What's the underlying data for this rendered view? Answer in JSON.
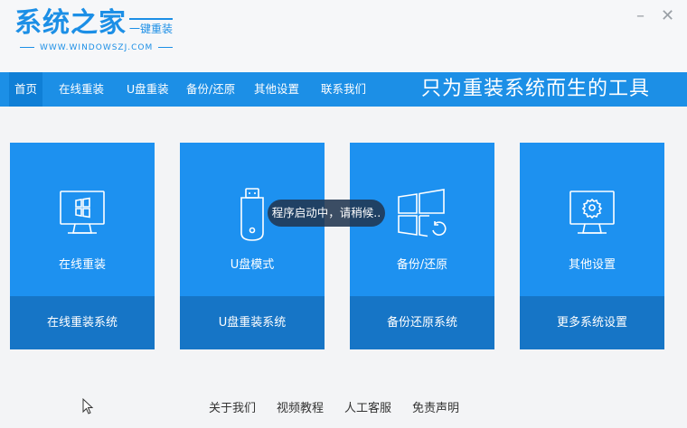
{
  "app": {
    "logo_main": "系统之家",
    "logo_sub": "一键重装",
    "logo_url": "WWW.WINDOWSZJ.COM"
  },
  "window": {
    "minimize": "–",
    "close": "✕"
  },
  "nav": {
    "items": [
      "首页",
      "在线重装",
      "U盘重装",
      "备份/还原",
      "其他设置",
      "联系我们"
    ],
    "active_index": 0,
    "slogan": "只为重装系统而生的工具"
  },
  "cards": [
    {
      "icon": "windows-monitor-icon",
      "title": "在线重装",
      "action": "在线重装系统"
    },
    {
      "icon": "usb-drive-icon",
      "title": "U盘模式",
      "action": "U盘重装系统"
    },
    {
      "icon": "windows-restore-icon",
      "title": "备份/还原",
      "action": "备份还原系统"
    },
    {
      "icon": "gear-monitor-icon",
      "title": "其他设置",
      "action": "更多系统设置"
    }
  ],
  "toast": "程序启动中，请稍候..",
  "footer": [
    "关于我们",
    "视频教程",
    "人工客服",
    "免责声明"
  ],
  "colors": {
    "brand": "#1c8fe6",
    "card": "#1d91f0",
    "card_bottom": "#1675c6"
  }
}
